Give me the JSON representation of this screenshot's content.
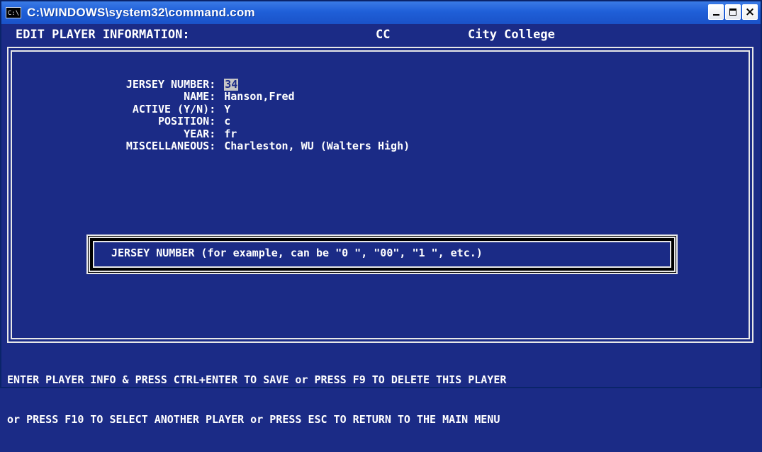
{
  "window": {
    "title": "C:\\WINDOWS\\system32\\command.com",
    "icon": "cmd-icon",
    "controls": {
      "minimize": "minimize-icon",
      "maximize": "maximize-icon",
      "close": "close-icon"
    }
  },
  "header": {
    "title": "EDIT PLAYER INFORMATION:",
    "team_code": "CC",
    "team_name": "City College"
  },
  "form": {
    "fields": [
      {
        "label": "JERSEY NUMBER:",
        "value": "34"
      },
      {
        "label": "NAME:",
        "value": "Hanson,Fred"
      },
      {
        "label": "ACTIVE (Y/N):",
        "value": "Y"
      },
      {
        "label": "POSITION:",
        "value": "c"
      },
      {
        "label": "YEAR:",
        "value": "fr"
      },
      {
        "label": "MISCELLANEOUS:",
        "value": "Charleston, WU (Walters High)"
      }
    ]
  },
  "hint": {
    "text": "JERSEY NUMBER (for example, can be \"0 \", \"00\", \"1 \", etc.)"
  },
  "footer": {
    "line1": "ENTER PLAYER INFO & PRESS CTRL+ENTER TO SAVE or PRESS F9 TO DELETE THIS PLAYER",
    "line2": "or PRESS F10 TO SELECT ANOTHER PLAYER or PRESS ESC TO RETURN TO THE MAIN MENU"
  },
  "colors": {
    "background": "#1b2b86",
    "text": "#ffffff",
    "titlebar": "#1f5fd8",
    "border": "#e8e8e8"
  }
}
